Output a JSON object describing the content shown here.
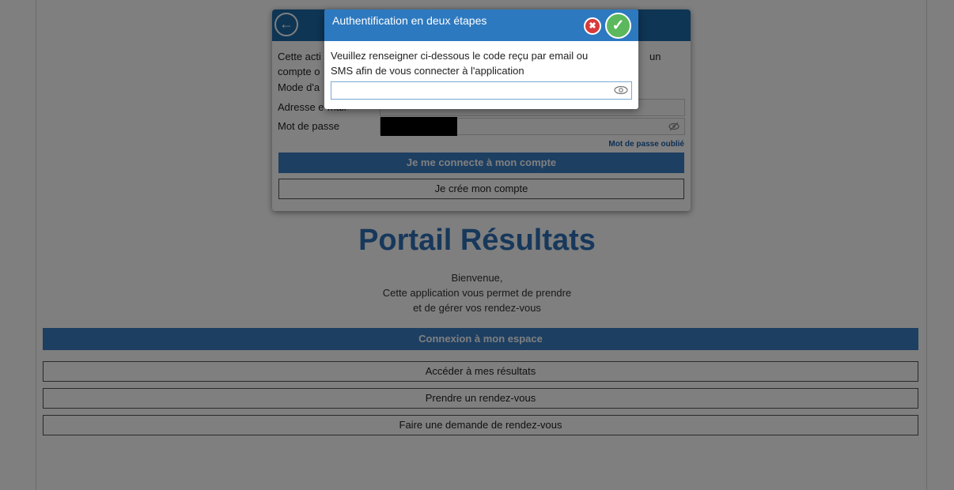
{
  "portal": {
    "title": "Portail Résultats",
    "welcome_lines": [
      "Bienvenue,",
      "Cette application vous permet de prendre",
      "et de gérer vos rendez-vous"
    ],
    "connect_label": "Connexion à mon espace",
    "buttons": [
      "Accéder à mes résultats",
      "Prendre un rendez-vous",
      "Faire une demande de rendez-vous"
    ]
  },
  "login": {
    "desc_line1": "Cette acti",
    "desc_line1_end": "un",
    "desc_line2": "compte o",
    "mode_label": "Mode d'a",
    "email_label": "Adresse e-mail",
    "email_value": "",
    "password_label": "Mot de passe",
    "forgot_label": "Mot de passe oublié",
    "connect_button": "Je me connecte à mon compte",
    "create_button": "Je crée mon compte"
  },
  "dialog": {
    "title": "Authentification en deux étapes",
    "message_line1": "Veuillez renseigner ci-dessous le code reçu par email ou",
    "message_line2": "SMS afin de vous connecter à l'application",
    "code_value": "",
    "close_glyph": "✖",
    "confirm_glyph": "✓"
  },
  "colors": {
    "header_blue": "#1d6aa8",
    "button_blue": "#3b7fc4",
    "title_blue": "#2f70b7",
    "close_red": "#d83a3a",
    "confirm_green": "#5cb85c"
  },
  "icons": {
    "back": "back-arrow-icon",
    "eye": "eye-icon",
    "eye_slash": "eye-slash-icon"
  }
}
